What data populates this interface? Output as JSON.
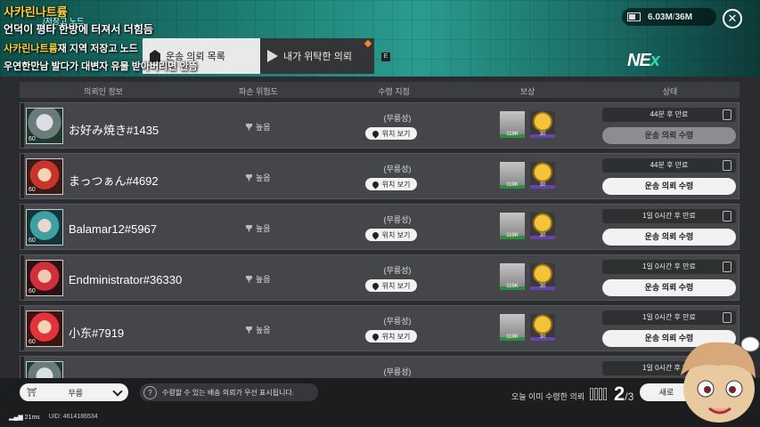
{
  "overlay_chat": [
    {
      "name": "사카린나트륨",
      "message": ""
    },
    {
      "name": "",
      "message": "언덕이 평타 한방에 터져서 더힘듬"
    },
    {
      "name": "사카린나트륨",
      "message": "재 지역 저장고 노드"
    },
    {
      "name": "",
      "message": "우연한만남 발다가 대변자 유물 받아버리면 안뜸"
    }
  ],
  "breadcrumb": "/저장고 노드",
  "tabs": [
    {
      "label": "운송 의뢰 목록",
      "active": true
    },
    {
      "label": "내가 위탁한 의뢰",
      "active": false
    }
  ],
  "badge_e": "E",
  "currency": {
    "amount": "6.03M",
    "max": "36M"
  },
  "table_headers": [
    "의뢰인 정보",
    "파손 위험도",
    "수령 지점",
    "보상",
    "상태"
  ],
  "rows": [
    {
      "level": "60",
      "name": "お好み焼き#1435",
      "risk": "높음",
      "dest": "(무릉성)",
      "loc": "위치 보기",
      "reward1": "119K",
      "reward2": "30",
      "timer": "44분 후 만료",
      "action": "운송 의뢰 수령",
      "dim": true
    },
    {
      "level": "60",
      "name": "まっつぁん#4692",
      "risk": "높음",
      "dest": "(무릉성)",
      "loc": "위치 보기",
      "reward1": "119K",
      "reward2": "30",
      "timer": "44분 후 만료",
      "action": "운송 의뢰 수령",
      "dim": false
    },
    {
      "level": "60",
      "name": "Balamar12#5967",
      "risk": "높음",
      "dest": "(무릉성)",
      "loc": "위치 보기",
      "reward1": "119K",
      "reward2": "30",
      "timer": "1일 0시간 후 만료",
      "action": "운송 의뢰 수령",
      "dim": false
    },
    {
      "level": "60",
      "name": "Endministrator#36330",
      "risk": "높음",
      "dest": "(무릉성)",
      "loc": "위치 보기",
      "reward1": "119K",
      "reward2": "30",
      "timer": "1일 0시간 후 만료",
      "action": "운송 의뢰 수령",
      "dim": false
    },
    {
      "level": "60",
      "name": "小东#7919",
      "risk": "높음",
      "dest": "(무릉성)",
      "loc": "위치 보기",
      "reward1": "119K",
      "reward2": "30",
      "timer": "1일 0시간 후 만료",
      "action": "운송 의뢰 수령",
      "dim": false
    },
    {
      "level": "25",
      "name": "",
      "risk": "",
      "dest": "(무릉성)",
      "loc": "",
      "reward1": "",
      "reward2": "",
      "timer": "1일 0시간 후 만료",
      "action": "",
      "dim": false
    }
  ],
  "filter": {
    "selected": "무릉"
  },
  "notice": "수령할 수 있는 배송 의뢰가 우선 표시됩니다.",
  "today_count": {
    "label": "오늘 이미 수령한 의뢰",
    "current": "2",
    "total": "/3"
  },
  "refresh_label": "새로",
  "status_bar": {
    "ping": "21ms",
    "uid": "UID: 4614186534"
  },
  "colors": {
    "accent": "#2fd8b5",
    "chat_name": "#ffd23a",
    "orange": "#f08a1e"
  }
}
